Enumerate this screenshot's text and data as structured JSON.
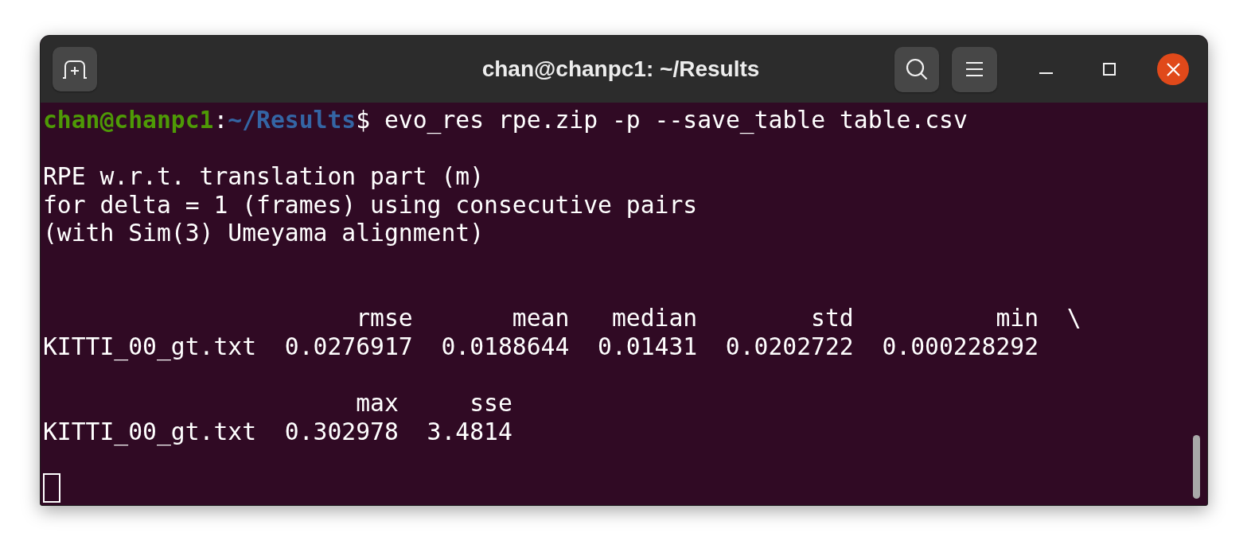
{
  "window": {
    "title": "chan@chanpc1: ~/Results"
  },
  "terminal": {
    "prompt": {
      "user_host": "chan@chanpc1",
      "separator": ":",
      "path": "~/Results",
      "symbol": "$",
      "command": "evo_res rpe.zip -p --save_table table.csv"
    },
    "output": [
      {
        "kind": "blank"
      },
      {
        "kind": "text",
        "text": "RPE w.r.t. translation part (m)"
      },
      {
        "kind": "text",
        "text": "for delta = 1 (frames) using consecutive pairs"
      },
      {
        "kind": "text",
        "text": "(with Sim(3) Umeyama alignment)"
      },
      {
        "kind": "blank"
      },
      {
        "kind": "blank"
      },
      {
        "kind": "table",
        "columns": [
          "rmse",
          "mean",
          "median",
          "std",
          "min"
        ],
        "continuation": "\\",
        "rows": [
          {
            "label": "KITTI_00_gt.txt",
            "cells": [
              "0.0276917",
              "0.0188644",
              "0.01431",
              "0.0202722",
              "0.000228292"
            ]
          }
        ]
      },
      {
        "kind": "blank"
      },
      {
        "kind": "table",
        "columns": [
          "max",
          "sse"
        ],
        "rows": [
          {
            "label": "KITTI_00_gt.txt",
            "cells": [
              "0.302978",
              "3.4814"
            ]
          }
        ]
      },
      {
        "kind": "blank"
      },
      {
        "kind": "cursor",
        "filled": false
      }
    ]
  }
}
